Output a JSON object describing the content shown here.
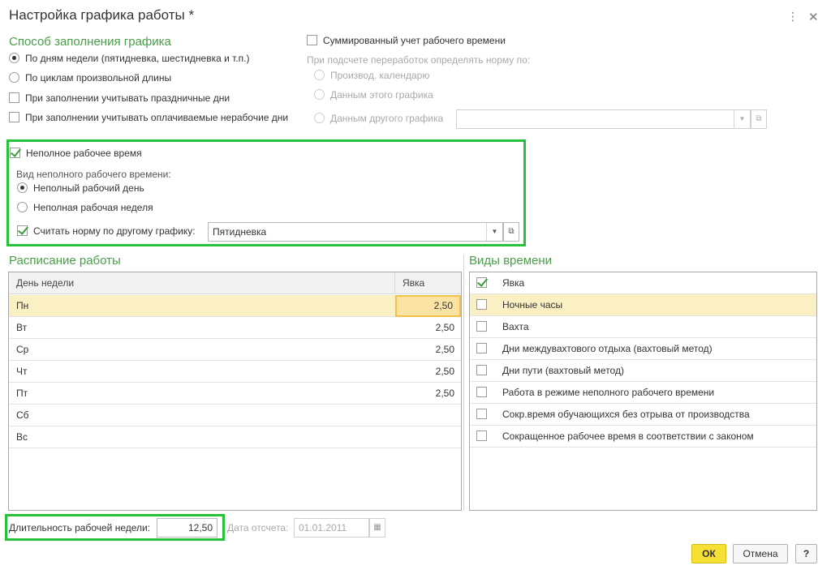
{
  "window": {
    "title": "Настройка графика работы *",
    "more_icon": "more-vert-icon",
    "close_icon": "close-icon"
  },
  "fill_method": {
    "section_title": "Способ заполнения графика",
    "options": [
      {
        "label": "По дням недели (пятидневка, шестидневка и т.п.)",
        "selected": true
      },
      {
        "label": "По циклам произвольной длины",
        "selected": false
      }
    ],
    "holidays_checkbox": {
      "label": "При заполнении учитывать праздничные дни",
      "checked": false
    },
    "paid_nonworking_checkbox": {
      "label": "При заполнении учитывать оплачиваемые нерабочие дни",
      "checked": false
    }
  },
  "summarized": {
    "checkbox_label": "Суммированный учет рабочего времени",
    "checked": false,
    "norm_caption": "При подсчете переработок определять норму по:",
    "options": [
      {
        "label": "Производ. календарю"
      },
      {
        "label": "Данным этого графика"
      },
      {
        "label": "Данным другого графика"
      }
    ],
    "other_schedule_value": ""
  },
  "part_time": {
    "checkbox_label": "Неполное рабочее время",
    "checked": true,
    "kind_caption": "Вид неполного рабочего времени:",
    "kind_options": [
      {
        "label": "Неполный рабочий день",
        "selected": true
      },
      {
        "label": "Неполная рабочая неделя",
        "selected": false
      }
    ],
    "norm_checkbox_label": "Считать норму по другому графику:",
    "norm_checked": true,
    "norm_schedule_value": "Пятидневка"
  },
  "schedule": {
    "section_title": "Расписание работы",
    "columns": [
      "День недели",
      "Явка"
    ],
    "rows": [
      {
        "day": "Пн",
        "value": "2,50"
      },
      {
        "day": "Вт",
        "value": "2,50"
      },
      {
        "day": "Ср",
        "value": "2,50"
      },
      {
        "day": "Чт",
        "value": "2,50"
      },
      {
        "day": "Пт",
        "value": "2,50"
      },
      {
        "day": "Сб",
        "value": ""
      },
      {
        "day": "Вс",
        "value": ""
      }
    ]
  },
  "time_types": {
    "section_title": "Виды времени",
    "items": [
      {
        "label": "Явка",
        "checked": true
      },
      {
        "label": "Ночные часы",
        "checked": false
      },
      {
        "label": "Вахта",
        "checked": false
      },
      {
        "label": "Дни междувахтового отдыха (вахтовый метод)",
        "checked": false
      },
      {
        "label": "Дни пути (вахтовый метод)",
        "checked": false
      },
      {
        "label": "Работа в режиме неполного рабочего времени",
        "checked": false
      },
      {
        "label": "Сокр.время обучающихся без отрыва от производства",
        "checked": false
      },
      {
        "label": "Сокращенное рабочее время в соответствии с законом",
        "checked": false
      }
    ]
  },
  "footer": {
    "week_length_label": "Длительность рабочей недели:",
    "week_length_value": "12,50",
    "ref_date_label": "Дата отсчета:",
    "ref_date_value": "01.01.2011",
    "ok_label": "ОК",
    "cancel_label": "Отмена",
    "help_label": "?"
  },
  "colors": {
    "section_title": "#4a9e4a",
    "highlight_border": "#27c23a",
    "ok_button": "#f7e034",
    "selected_row": "#fbefc4"
  }
}
